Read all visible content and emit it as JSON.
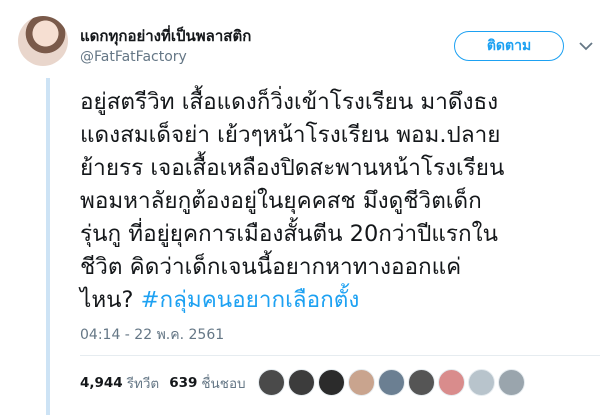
{
  "author": {
    "display_name": "แดกทุกอย่างที่เป็นพลาสติก",
    "handle": "@FatFatFactory"
  },
  "follow_button": {
    "label": "ติดตาม"
  },
  "tweet": {
    "text": "อยู่สตรีวิท เสื้อแดงก็วิ่งเข้าโรงเรียน มาดึงธง\nแดงสมเด็จย่า เย้วๆหน้าโรงเรียน พอม.ปลาย\nย้ายรร เจอเสื้อเหลืองปิดสะพานหน้าโรงเรียน\nพอมหาลัยกูต้องอยู่ในยุคคสช มึงดูชีวิตเด็ก\nรุ่นกู ที่อยู่ยุคการเมืองสั้นตีน 20กว่าปีแรกใน\nชีวิต  คิดว่าเด็กเจนนี้อยากหาทางออกแค่\nไหน? ",
    "hashtag": "#กลุ่มคนอยากเลือกตั้ง",
    "timestamp": "04:14 - 22 พ.ค. 2561"
  },
  "stats": {
    "retweets_count": "4,944",
    "retweets_label": "รีทวีต",
    "likes_count": "639",
    "likes_label": "ชื่นชอบ"
  },
  "colors": {
    "accent": "#1da1f2",
    "text": "#14171a",
    "muted": "#657786",
    "thread_line": "#cde3f5"
  },
  "liker_avatars": [
    "#4a4a4a",
    "#3c3c3c",
    "#2b2b2b",
    "#c9a48e",
    "#6b7f92",
    "#555555",
    "#d98c8c",
    "#b8c4cc",
    "#9aa5ad"
  ]
}
